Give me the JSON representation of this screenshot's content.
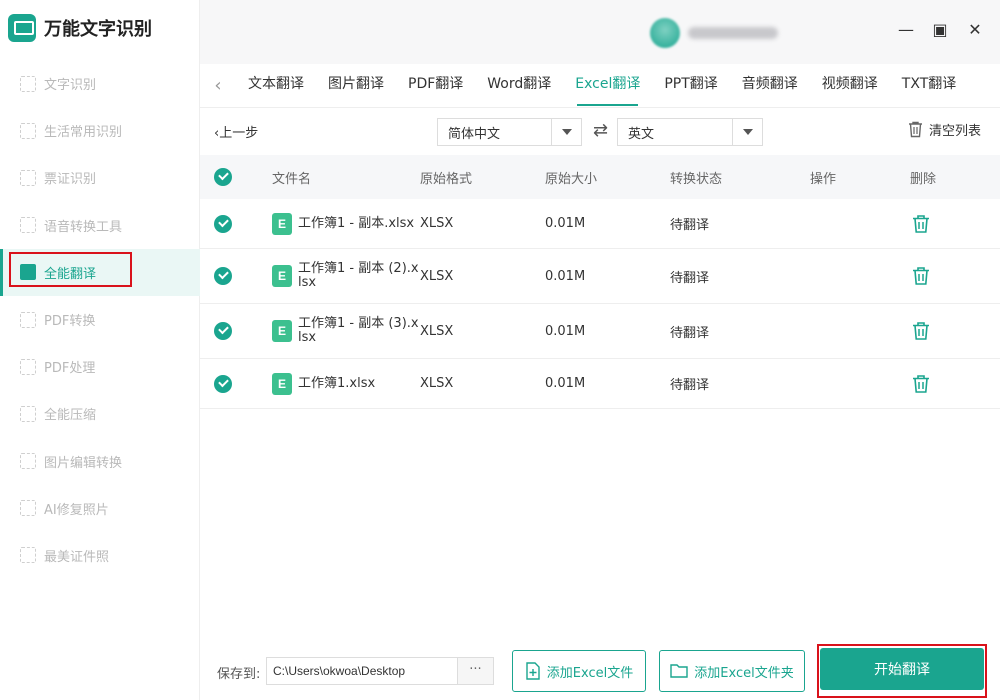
{
  "app": {
    "title": "万能文字识别"
  },
  "sidebar": {
    "items": [
      {
        "label": "文字识别",
        "active": false
      },
      {
        "label": "生活常用识别",
        "active": false
      },
      {
        "label": "票证识别",
        "active": false
      },
      {
        "label": "语音转换工具",
        "active": false
      },
      {
        "label": "全能翻译",
        "active": true
      },
      {
        "label": "PDF转换",
        "active": false
      },
      {
        "label": "PDF处理",
        "active": false
      },
      {
        "label": "全能压缩",
        "active": false
      },
      {
        "label": "图片编辑转换",
        "active": false
      },
      {
        "label": "AI修复照片",
        "active": false
      },
      {
        "label": "最美证件照",
        "active": false
      }
    ]
  },
  "tabs": [
    {
      "label": "文本翻译",
      "active": false
    },
    {
      "label": "图片翻译",
      "active": false
    },
    {
      "label": "PDF翻译",
      "active": false
    },
    {
      "label": "Word翻译",
      "active": false
    },
    {
      "label": "Excel翻译",
      "active": true
    },
    {
      "label": "PPT翻译",
      "active": false
    },
    {
      "label": "音频翻译",
      "active": false
    },
    {
      "label": "视频翻译",
      "active": false
    },
    {
      "label": "TXT翻译",
      "active": false
    }
  ],
  "toolbar": {
    "back_label": "上一步",
    "source_lang": "简体中文",
    "target_lang": "英文",
    "clear_label": "清空列表"
  },
  "table": {
    "headers": {
      "name": "文件名",
      "format": "原始格式",
      "size": "原始大小",
      "status": "转换状态",
      "op": "操作",
      "del": "删除"
    },
    "rows": [
      {
        "icon": "E",
        "name": "工作簿1 - 副本.xlsx",
        "format": "XLSX",
        "size": "0.01M",
        "status": "待翻译"
      },
      {
        "icon": "E",
        "name": "工作簿1 - 副本 (2).xlsx",
        "format": "XLSX",
        "size": "0.01M",
        "status": "待翻译"
      },
      {
        "icon": "E",
        "name": "工作簿1 - 副本 (3).xlsx",
        "format": "XLSX",
        "size": "0.01M",
        "status": "待翻译"
      },
      {
        "icon": "E",
        "name": "工作簿1.xlsx",
        "format": "XLSX",
        "size": "0.01M",
        "status": "待翻译"
      }
    ]
  },
  "footer": {
    "save_label": "保存到:",
    "save_path": "C:\\Users\\okwoa\\Desktop",
    "browse_label": "···",
    "add_file_label": "添加Excel文件",
    "add_folder_label": "添加Excel文件夹",
    "start_label": "开始翻译"
  },
  "colors": {
    "accent": "#1aa58f",
    "highlight": "#d9121b"
  }
}
